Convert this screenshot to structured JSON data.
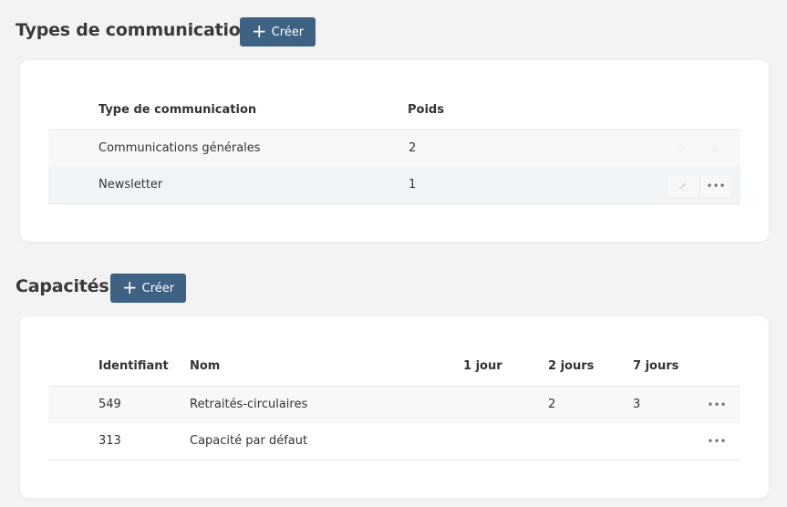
{
  "sections": {
    "types": {
      "title": "Types de communications",
      "create_label": "Créer",
      "columns": [
        "Type de communication",
        "Poids"
      ],
      "rows": [
        {
          "type": "Communications générales",
          "weight": "2"
        },
        {
          "type": "Newsletter",
          "weight": "1"
        }
      ]
    },
    "capacities": {
      "title": "Capacités",
      "create_label": "Créer",
      "columns": [
        "Identifiant",
        "Nom",
        "1 jour",
        "2 jours",
        "7 jours"
      ],
      "rows": [
        {
          "id": "549",
          "name": "Retraités-circulaires",
          "day1": "",
          "day2": "2",
          "day7": "3"
        },
        {
          "id": "313",
          "name": "Capacité par défaut",
          "day1": "",
          "day2": "",
          "day7": ""
        }
      ]
    }
  },
  "icons": {
    "plus": "plus-icon",
    "edit": "pencil-icon",
    "more": "more-dots-icon",
    "delete": "trash-icon"
  },
  "colors": {
    "background": "#f3f3f3",
    "button": "#3d6284",
    "row_alt": "#f8f8f8",
    "row_hover": "#f1f4f7"
  }
}
